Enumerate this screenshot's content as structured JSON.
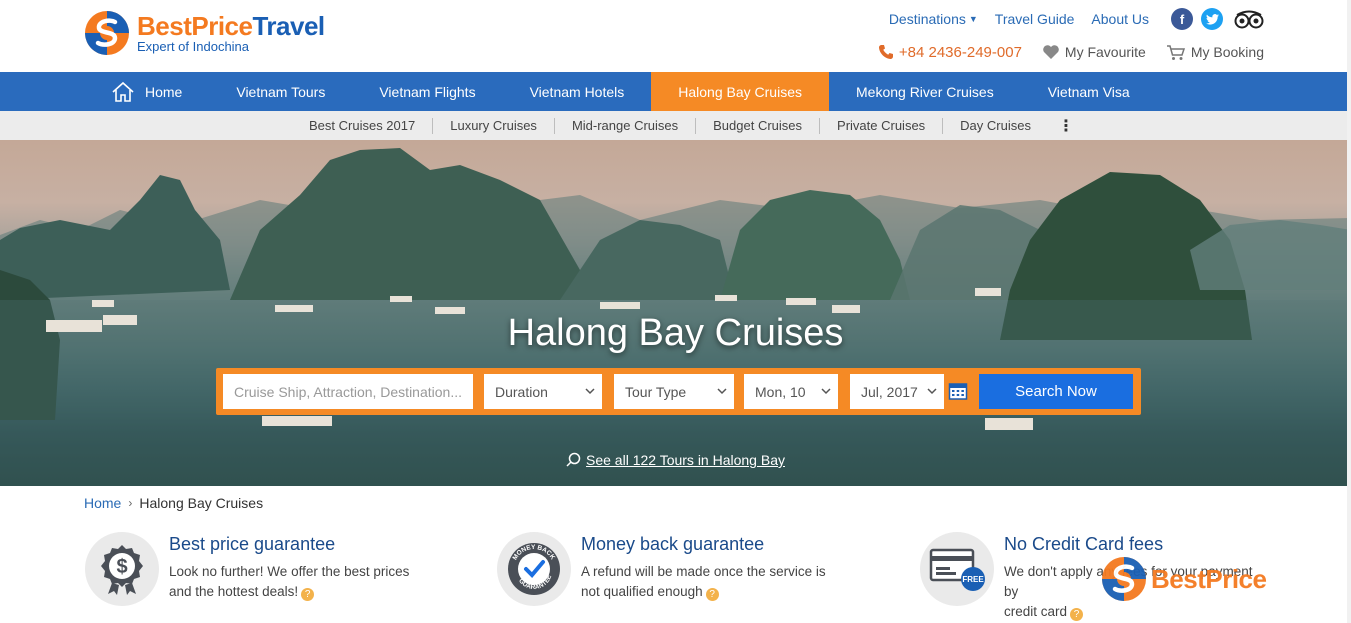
{
  "brand": {
    "name_part1": "BestPrice",
    "name_part2": "Travel",
    "tagline": "Expert of Indochina"
  },
  "top_links": {
    "destinations": "Destinations",
    "travel_guide": "Travel Guide",
    "about_us": "About Us",
    "phone": "+84 2436-249-007",
    "favourite": "My Favourite",
    "booking": "My Booking"
  },
  "main_nav": [
    {
      "label": "Home"
    },
    {
      "label": "Vietnam Tours"
    },
    {
      "label": "Vietnam Flights"
    },
    {
      "label": "Vietnam Hotels"
    },
    {
      "label": "Halong Bay Cruises"
    },
    {
      "label": "Mekong River Cruises"
    },
    {
      "label": "Vietnam Visa"
    }
  ],
  "sub_nav": [
    {
      "label": "Best Cruises 2017"
    },
    {
      "label": "Luxury Cruises"
    },
    {
      "label": "Mid-range Cruises"
    },
    {
      "label": "Budget Cruises"
    },
    {
      "label": "Private Cruises"
    },
    {
      "label": "Day Cruises"
    }
  ],
  "hero": {
    "title": "Halong Bay Cruises",
    "search": {
      "placeholder": "Cruise Ship, Attraction, Destination...",
      "duration": "Duration",
      "tour_type": "Tour Type",
      "day": "Mon, 10",
      "month": "Jul, 2017",
      "button": "Search Now"
    },
    "see_all": "See all 122 Tours in Halong Bay"
  },
  "breadcrumb": {
    "home": "Home",
    "current": "Halong Bay Cruises"
  },
  "features": [
    {
      "title": "Best price guarantee",
      "text_line1": "Look no further! We offer the best prices",
      "text_line2": "and the hottest deals!"
    },
    {
      "title": "Money back guarantee",
      "text_line1": "A refund will be made once the service is",
      "text_line2": "not qualified enough"
    },
    {
      "title": "No Credit Card fees",
      "text_line1": "We don't apply any fees for your payment by",
      "text_line2": "credit card"
    }
  ],
  "feature_badges": {
    "money_back": "MONEY BACK GUARANTEE",
    "free": "FREE"
  },
  "watermark": "BestPrice",
  "colors": {
    "nav_blue": "#2a6bbd",
    "active_orange": "#f58a25",
    "search_button": "#1a6ee0",
    "brand_orange": "#f47a20",
    "brand_blue": "#1a5fb4"
  }
}
